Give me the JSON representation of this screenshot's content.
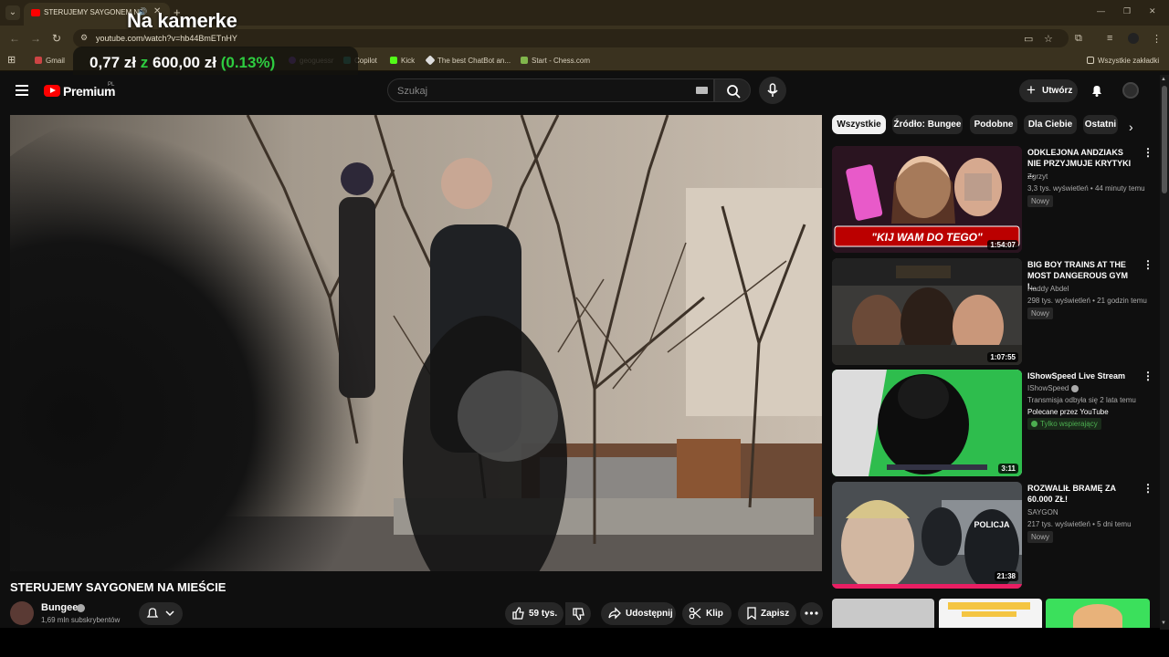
{
  "browser": {
    "tab_title": "STERUJEMY SAYGONEM NA",
    "url": "youtube.com/watch?v=hb44BmETnHY",
    "bookmarks": [
      "Gmail",
      "geoguessr",
      "Copilot",
      "Kick",
      "The best ChatBot an...",
      "Start - Chess.com"
    ],
    "all_bookmarks": "Wszystkie zakładki"
  },
  "overlay": {
    "title": "Na kamerke",
    "ticker_amount": "0,77 zł",
    "ticker_sep": "z",
    "ticker_total": "600,00 zł",
    "ticker_pct": "(0.13%)"
  },
  "header": {
    "logo": "Premium",
    "country": "PL",
    "search_placeholder": "Szukaj",
    "create_label": "Utwórz"
  },
  "video": {
    "title": "STERUJEMY SAYGONEM NA MIEŚCIE",
    "channel": "Bungee",
    "subscribers": "1,69 mln subskrybentów",
    "likes": "59 tys.",
    "share": "Udostępnij",
    "clip": "Klip",
    "save": "Zapisz"
  },
  "chips": [
    "Wszystkie",
    "Źródło: Bungee",
    "Podobne",
    "Dla Ciebie",
    "Ostatni"
  ],
  "recommendations": [
    {
      "title": "ODKLEJONA ANDZIAKS NIE PRZYJMUJE KRYTYKI ...",
      "channel": "Zgrzyt",
      "meta": "3,3 tys. wyświetleń • 44 minuty temu",
      "badge": "Nowy",
      "duration": "1:54:07",
      "thumb_caption": "\"KIJ WAM DO TEGO\""
    },
    {
      "title": "BIG BOY TRAINS AT THE MOST DANGEROUS GYM I...",
      "channel": "Haddy Abdel",
      "meta": "298 tys. wyświetleń • 21 godzin temu",
      "badge": "Nowy",
      "duration": "1:07:55"
    },
    {
      "title": "IShowSpeed Live Stream",
      "channel": "IShowSpeed",
      "meta": "Transmisja odbyła się 2 lata temu",
      "extra": "Polecane przez YouTube",
      "members": "Tylko wspierający",
      "duration": "3:11"
    },
    {
      "title": "ROZWALIŁ BRAMĘ ZA 60.000 ZŁ!",
      "channel": "SAYGON",
      "meta": "217 tys. wyświetleń • 5 dni temu",
      "badge": "Nowy",
      "duration": "21:38",
      "thumb_caption": "POLICJA"
    }
  ]
}
